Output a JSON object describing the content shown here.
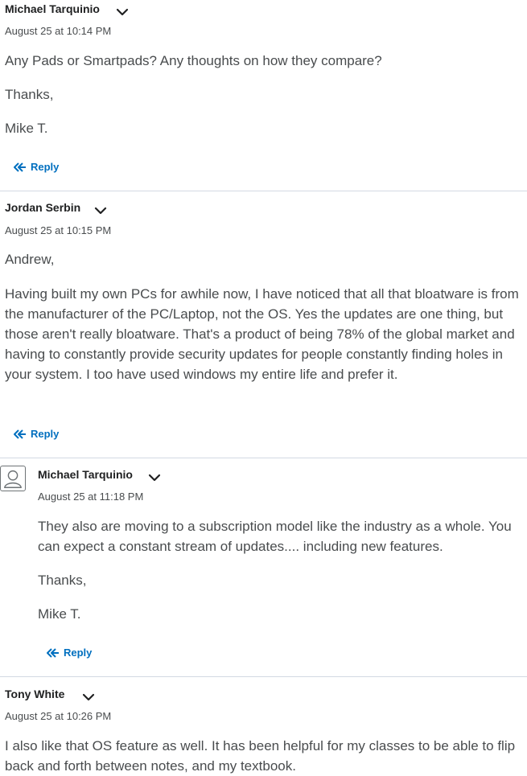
{
  "posts": [
    {
      "author": "Michael Tarquinio",
      "date": "August 25 at 10:14 PM",
      "paragraphs": [
        "Any Pads or Smartpads?  Any thoughts on how they compare?",
        "Thanks,",
        "Mike T."
      ],
      "reply_label": "Reply"
    },
    {
      "author": "Jordan Serbin",
      "date": "August 25 at 10:15 PM",
      "paragraphs": [
        "Andrew,",
        "Having built my own PCs for awhile now, I have noticed that all that bloatware is from the manufacturer of the PC/Laptop, not the OS. Yes the updates are one thing, but those aren't really bloatware. That's a product of being 78% of the global market and having to constantly provide security updates for people constantly finding holes in your system. I too have used windows my entire life and prefer it."
      ],
      "reply_label": "Reply"
    },
    {
      "author": "Michael Tarquinio",
      "date": "August 25 at 11:18 PM",
      "paragraphs": [
        "They also are moving to a subscription model like the industry as a whole.  You can expect a constant stream of updates.... including new features.",
        "Thanks,",
        "Mike T."
      ],
      "reply_label": "Reply"
    },
    {
      "author": "Tony White",
      "date": "August 25 at 10:26 PM",
      "paragraphs": [
        "I also like that OS feature as well. It has been helpful for my classes to be able to flip back and forth between notes, and my textbook."
      ]
    }
  ],
  "icons": {
    "menu": "chevron-down-icon",
    "reply": "reply-arrow-icon",
    "avatar": "user-avatar-icon"
  },
  "colors": {
    "link": "#006fbf",
    "divider": "#d3d9e3",
    "text": "#494c4e",
    "author": "#202122"
  }
}
